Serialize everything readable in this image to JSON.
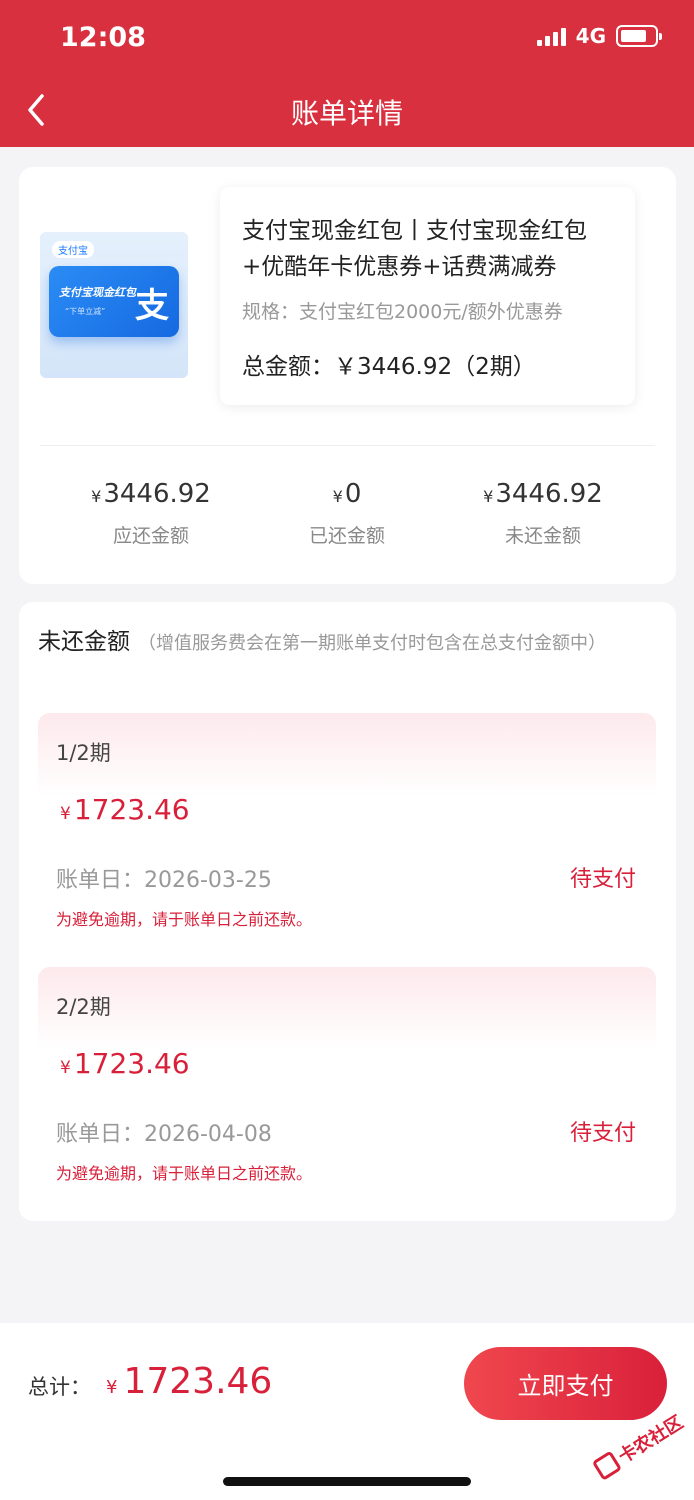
{
  "status_bar": {
    "time": "12:08",
    "network": "4G"
  },
  "header": {
    "title": "账单详情"
  },
  "product": {
    "thumb_logo": "支付宝",
    "thumb_text": "支付宝现金红包",
    "thumb_sub": "“下单立减”",
    "thumb_glyph": "支",
    "name": "支付宝现金红包丨支付宝现金红包+优酷年卡优惠券+话费满减券",
    "spec": "规格：支付宝红包2000元/额外优惠券",
    "total_label": "总金额：",
    "total_value": "￥3446.92",
    "periods": "（2期）"
  },
  "summary": {
    "due": {
      "symbol": "¥",
      "value": "3446.92",
      "label": "应还金额"
    },
    "paid": {
      "symbol": "¥",
      "value": "0",
      "label": "已还金额"
    },
    "unpaid": {
      "symbol": "¥",
      "value": "3446.92",
      "label": "未还金额"
    }
  },
  "unpaid_section": {
    "title": "未还金额",
    "note": "（增值服务费会在第一期账单支付时包含在总支付金额中）",
    "installments": [
      {
        "period": "1/2期",
        "symbol": "¥",
        "amount": "1723.46",
        "date": "账单日：2026-03-25",
        "status": "待支付",
        "tip": "为避免逾期，请于账单日之前还款。"
      },
      {
        "period": "2/2期",
        "symbol": "¥",
        "amount": "1723.46",
        "date": "账单日：2026-04-08",
        "status": "待支付",
        "tip": "为避免逾期，请于账单日之前还款。"
      }
    ]
  },
  "bottom_bar": {
    "total_label": "总计：",
    "symbol": "¥",
    "total_value": "1723.46",
    "pay_button": "立即支付"
  },
  "watermark": {
    "text": "卡农社区"
  },
  "colors": {
    "brand_red": "#d9303f",
    "accent_red": "#d9203a",
    "background": "#f4f4f6"
  }
}
